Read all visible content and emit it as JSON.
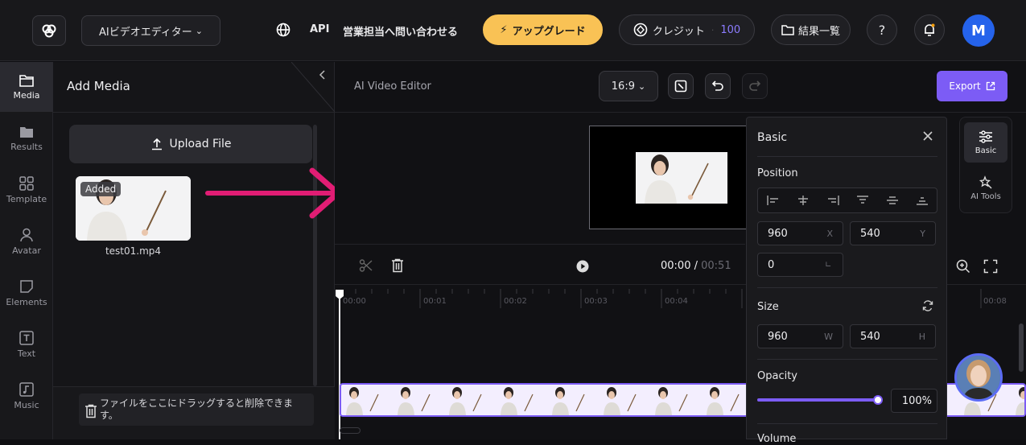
{
  "topbar": {
    "app_menu": "AIビデオエディター",
    "api": "API",
    "sales": "営業担当へ問い合わせる",
    "upgrade": "アップグレード",
    "credits_label": "クレジット",
    "credits_value": "100",
    "results_list": "結果一覧",
    "help": "?",
    "avatar_letter": "M",
    "accent_upgrade": "#f9c255",
    "accent_avatar": "#2563eb"
  },
  "sidebar": {
    "items": [
      {
        "label": "Media",
        "icon": "folder-icon"
      },
      {
        "label": "Results",
        "icon": "folder-filled-icon"
      },
      {
        "label": "Template",
        "icon": "grid-icon"
      },
      {
        "label": "Avatar",
        "icon": "person-icon"
      },
      {
        "label": "Elements",
        "icon": "sticker-icon"
      },
      {
        "label": "Text",
        "icon": "text-icon"
      },
      {
        "label": "Music",
        "icon": "music-icon"
      }
    ]
  },
  "media": {
    "title": "Add Media",
    "upload": "Upload File",
    "file_badge": "Added",
    "file_name": "test01.mp4",
    "drop_hint": "ファイルをここにドラッグすると削除できます。"
  },
  "editor": {
    "title": "AI Video Editor",
    "ratio": "16:9",
    "export": "Export",
    "time_current": "00:00",
    "time_sep": " / ",
    "time_total": "00:51",
    "ticks": [
      "00:00",
      "00:01",
      "00:02",
      "00:03",
      "00:04",
      "00:08"
    ],
    "accent": "#7c5cf5"
  },
  "basic": {
    "title": "Basic",
    "position_label": "Position",
    "x_value": "960",
    "x_suffix": "X",
    "y_value": "540",
    "y_suffix": "Y",
    "rotation_value": "0",
    "size_label": "Size",
    "w_value": "960",
    "w_suffix": "W",
    "h_value": "540",
    "h_suffix": "H",
    "opacity_label": "Opacity",
    "opacity_value": "100%",
    "opacity_level": 1.0,
    "volume_label": "Volume"
  },
  "tools": {
    "basic": "Basic",
    "ai_tools": "AI Tools"
  }
}
